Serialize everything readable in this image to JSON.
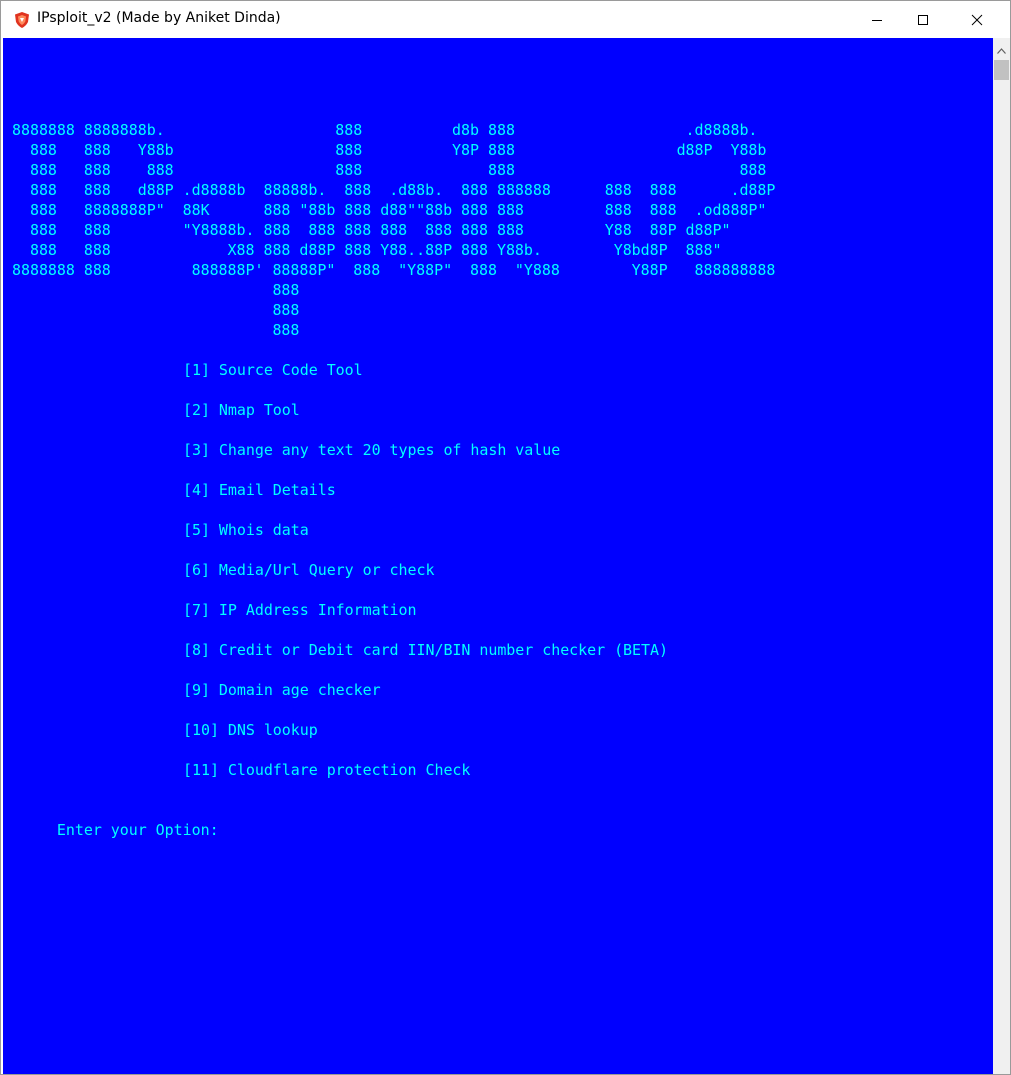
{
  "window": {
    "title": "IPsploit_v2 (Made by Aniket Dinda)",
    "icon": "shield-icon",
    "controls": {
      "minimize": "minimize-icon",
      "maximize": "maximize-icon",
      "close": "close-icon"
    }
  },
  "colors": {
    "console_bg": "#0000ff",
    "console_fg": "#00ffff"
  },
  "console": {
    "banner": [
      "8888888 8888888b.                   888          d8b 888                   .d8888b.",
      "  888   888   Y88b                  888          Y8P 888                  d88P  Y88b",
      "  888   888    888                  888              888                         888",
      "  888   888   d88P .d8888b  88888b.  888  .d88b.  888 888888      888  888      .d88P",
      "  888   8888888P\"  88K      888 \"88b 888 d88\"\"88b 888 888         888  888  .od888P\"",
      "  888   888        \"Y8888b. 888  888 888 888  888 888 888         Y88  88P d88P\"",
      "  888   888             X88 888 d88P 888 Y88..88P 888 Y88b.        Y8bd8P  888\"",
      "8888888 888         888888P' 88888P\"  888  \"Y88P\"  888  \"Y888        Y88P   888888888",
      "                             888",
      "                             888",
      "                             888"
    ],
    "menu": [
      "[1] Source Code Tool",
      "[2] Nmap Tool",
      "[3] Change any text 20 types of hash value",
      "[4] Email Details",
      "[5] Whois data",
      "[6] Media/Url Query or check",
      "[7] IP Address Information",
      "[8] Credit or Debit card IIN/BIN number checker (BETA)",
      "[9] Domain age checker",
      "[10] DNS lookup",
      "[11] Cloudflare protection Check"
    ],
    "prompt": "Enter your Option:"
  }
}
